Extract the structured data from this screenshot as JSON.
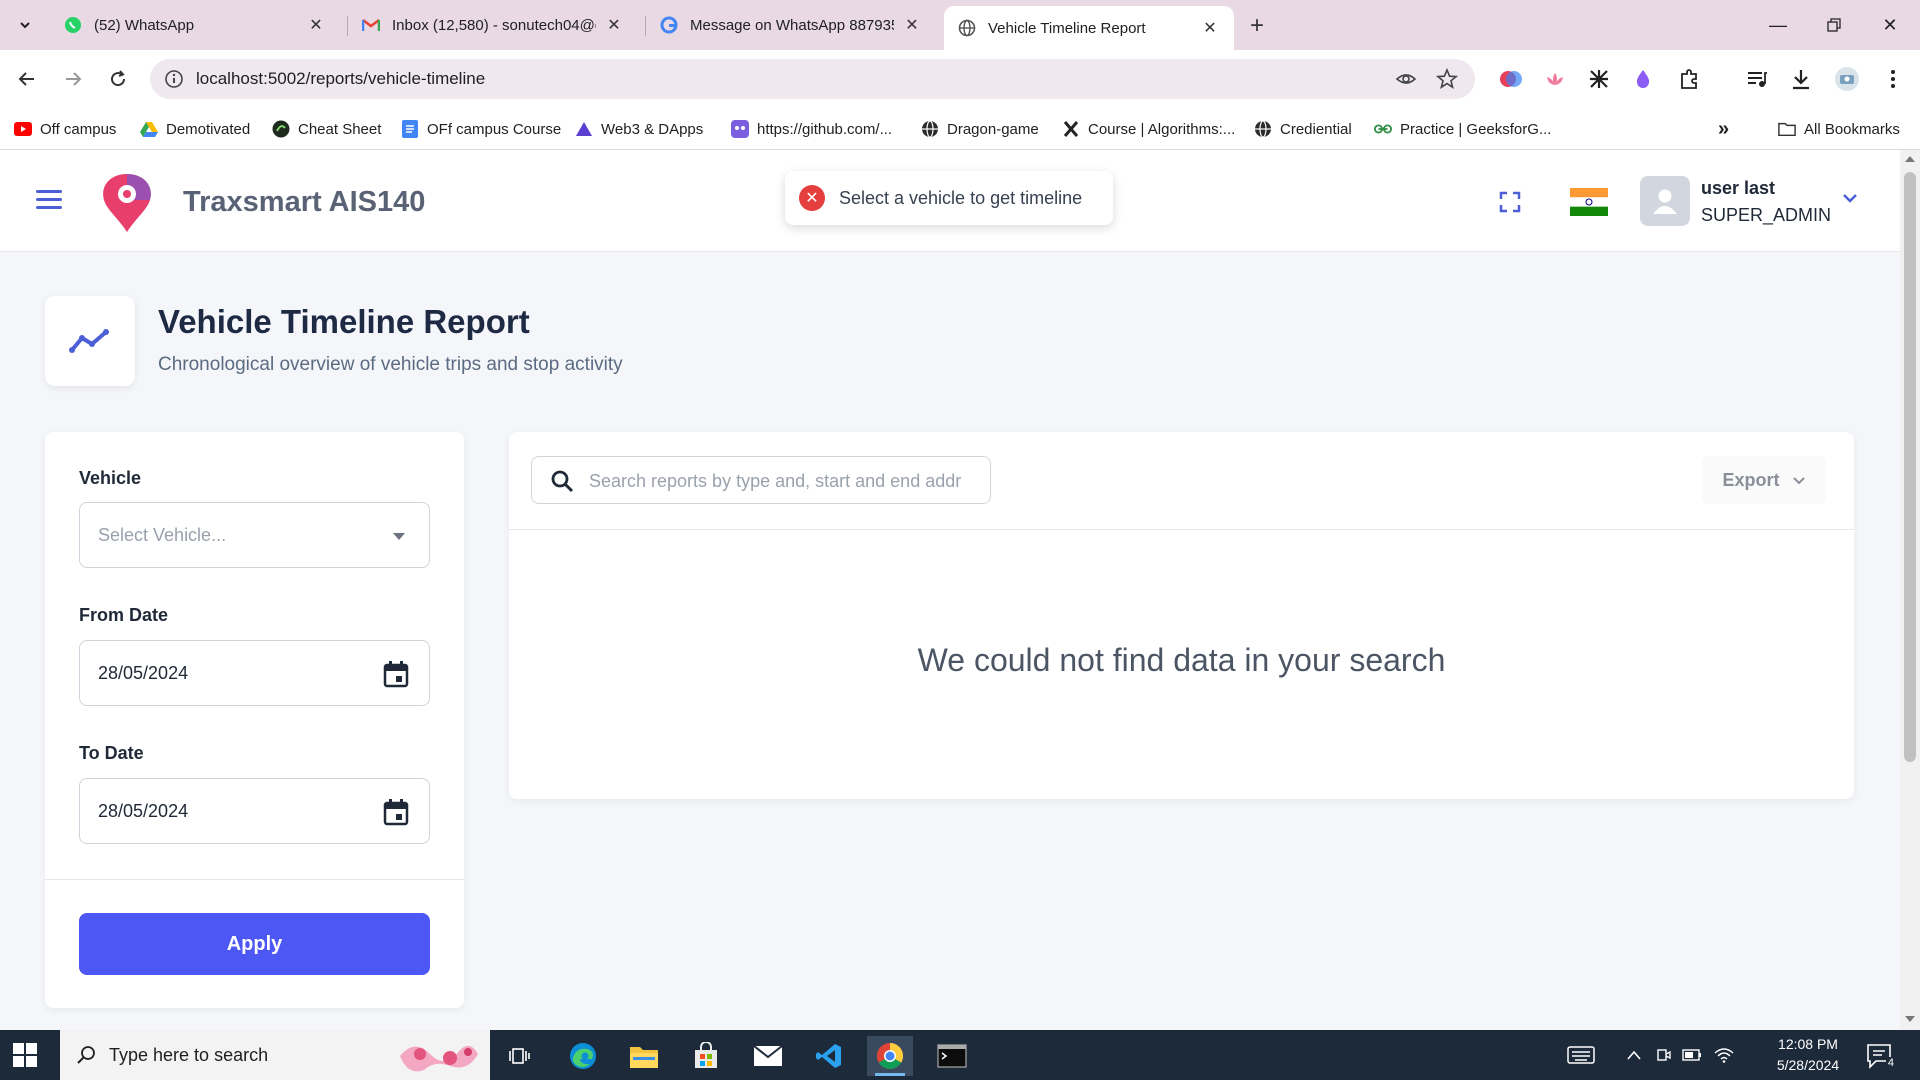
{
  "browser": {
    "tabs": [
      {
        "title": "(52) WhatsApp",
        "icon": "whatsapp-icon"
      },
      {
        "title": "Inbox (12,580) - sonutech04@g",
        "icon": "gmail-icon"
      },
      {
        "title": "Message on WhatsApp 887935",
        "icon": "google-icon"
      },
      {
        "title": "Vehicle Timeline Report",
        "icon": "globe-icon"
      }
    ],
    "url": "localhost:5002/reports/vehicle-timeline",
    "bookmarks": [
      {
        "label": "Off campus",
        "icon": "youtube-icon"
      },
      {
        "label": "Demotivated",
        "icon": "drive-icon"
      },
      {
        "label": "Cheat Sheet",
        "icon": "cheatsheet-icon"
      },
      {
        "label": "OFf campus Course",
        "icon": "docs-icon"
      },
      {
        "label": "Web3 & DApps",
        "icon": "triangle-icon"
      },
      {
        "label": "https://github.com/...",
        "icon": "github-icon"
      },
      {
        "label": "Dragon-game",
        "icon": "globe-icon"
      },
      {
        "label": "Course | Algorithms:...",
        "icon": "x-icon"
      },
      {
        "label": "Crediential",
        "icon": "globe-icon"
      },
      {
        "label": "Practice | GeeksforG...",
        "icon": "gfg-icon"
      }
    ],
    "all_bookmarks": "All Bookmarks"
  },
  "app": {
    "brand": "Traxsmart AIS140",
    "user": {
      "name": "user last",
      "role": "SUPER_ADMIN"
    },
    "toast": "Select a vehicle to get timeline",
    "page": {
      "title": "Vehicle Timeline Report",
      "subtitle": "Chronological overview of vehicle trips and stop activity"
    },
    "filters": {
      "vehicle_label": "Vehicle",
      "vehicle_placeholder": "Select Vehicle...",
      "from_label": "From Date",
      "from_value": "28/05/2024",
      "to_label": "To Date",
      "to_value": "28/05/2024",
      "apply_label": "Apply"
    },
    "results": {
      "search_placeholder": "Search reports by type and, start and end addr",
      "export_label": "Export",
      "empty_message": "We could not find data in your search"
    },
    "colors": {
      "accent": "#4d57f3",
      "error": "#e53e3e",
      "brand_text": "#5a6275"
    }
  },
  "taskbar": {
    "search_placeholder": "Type here to search",
    "time": "12:08 PM",
    "date": "5/28/2024",
    "notification_count": "4"
  }
}
